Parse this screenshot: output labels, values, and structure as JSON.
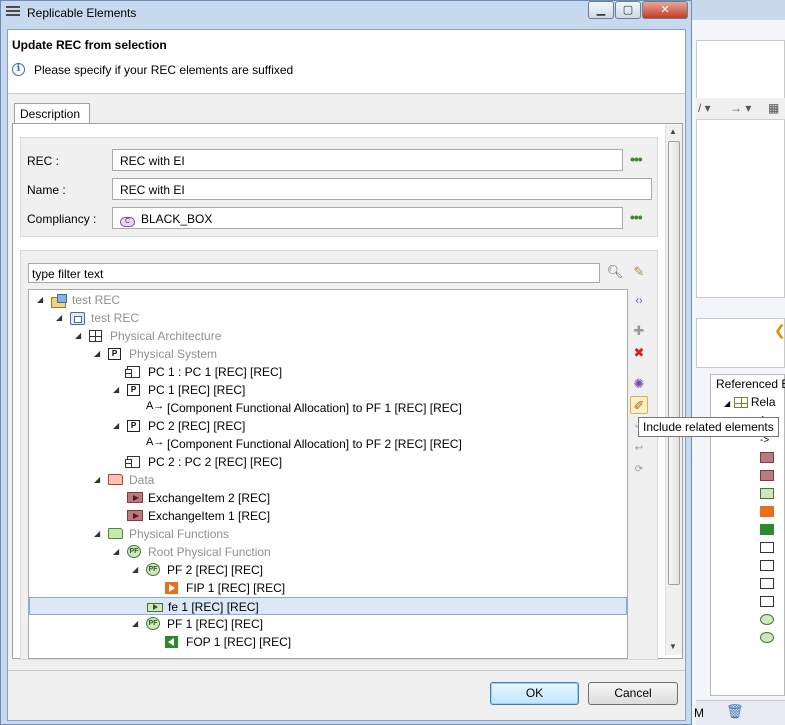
{
  "dialog": {
    "title": "Replicable Elements",
    "header_title": "Update REC from selection",
    "header_message": "Please specify if your REC elements are suffixed",
    "tab_label": "Description",
    "ok_label": "OK",
    "cancel_label": "Cancel"
  },
  "form": {
    "rec_label": "REC :",
    "rec_value": "REC with EI",
    "name_label": "Name :",
    "name_value": "REC with EI",
    "compliancy_label": "Compliancy :",
    "compliancy_value": "BLACK_BOX",
    "compliancy_icon_text": "C",
    "dots": "•••"
  },
  "filter": {
    "value": "type filter text"
  },
  "tree": [
    {
      "label": "test REC",
      "icon": "pkg",
      "indent": 0,
      "expanded": true,
      "dim": true
    },
    {
      "label": "test REC",
      "icon": "rec",
      "indent": 1,
      "expanded": true,
      "dim": true
    },
    {
      "label": "Physical Architecture",
      "icon": "arch",
      "indent": 2,
      "expanded": true,
      "dim": true
    },
    {
      "label": "Physical System",
      "icon": "box-p",
      "indent": 3,
      "expanded": true,
      "dim": true
    },
    {
      "label": "PC 1 : PC 1 [REC] [REC]",
      "icon": "comp",
      "indent": 4,
      "expanded": null,
      "dim": false
    },
    {
      "label": "PC 1 [REC] [REC]",
      "icon": "box-p",
      "indent": 4,
      "expanded": true,
      "dim": false
    },
    {
      "label": "[Component Functional Allocation] to PF 1 [REC] [REC]",
      "icon": "alloc",
      "indent": 5,
      "expanded": null,
      "dim": false
    },
    {
      "label": "PC 2 [REC] [REC]",
      "icon": "box-p",
      "indent": 4,
      "expanded": true,
      "dim": false
    },
    {
      "label": "[Component Functional Allocation] to PF 2 [REC] [REC]",
      "icon": "alloc",
      "indent": 5,
      "expanded": null,
      "dim": false
    },
    {
      "label": "PC 2 : PC 2 [REC] [REC]",
      "icon": "comp",
      "indent": 4,
      "expanded": null,
      "dim": false
    },
    {
      "label": "Data",
      "icon": "folder-red",
      "indent": 3,
      "expanded": true,
      "dim": true
    },
    {
      "label": "ExchangeItem 2 [REC]",
      "icon": "exch",
      "indent": 4,
      "expanded": null,
      "dim": false
    },
    {
      "label": "ExchangeItem 1 [REC]",
      "icon": "exch",
      "indent": 4,
      "expanded": null,
      "dim": false
    },
    {
      "label": "Physical Functions",
      "icon": "folder-green",
      "indent": 3,
      "expanded": true,
      "dim": true
    },
    {
      "label": "Root Physical Function",
      "icon": "pf",
      "indent": 4,
      "expanded": true,
      "dim": true
    },
    {
      "label": "PF 2 [REC] [REC]",
      "icon": "pf",
      "indent": 5,
      "expanded": true,
      "dim": false
    },
    {
      "label": "FIP 1 [REC] [REC]",
      "icon": "fip",
      "indent": 6,
      "expanded": null,
      "dim": false
    },
    {
      "label": "fe 1 [REC] [REC]",
      "icon": "fe",
      "indent": 5,
      "expanded": null,
      "dim": false,
      "selected": true
    },
    {
      "label": "PF 1 [REC] [REC]",
      "icon": "pf",
      "indent": 5,
      "expanded": true,
      "dim": false
    },
    {
      "label": "FOP 1 [REC] [REC]",
      "icon": "fop",
      "indent": 6,
      "expanded": null,
      "dim": false
    }
  ],
  "tooltip": "Include related elements",
  "pf_icon_text": "PF",
  "p_icon_text": "P",
  "background_app": {
    "panel_title": "Referenced E",
    "tree_first": "Rela",
    "bottom_letter": "M"
  }
}
